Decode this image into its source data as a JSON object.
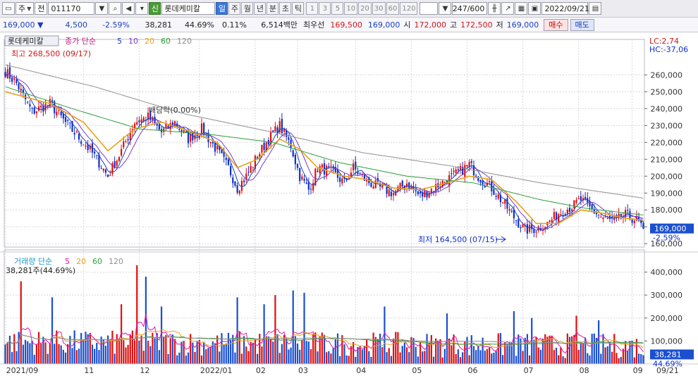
{
  "toolbar": {
    "period_a": "주",
    "period_b": "전",
    "code": "011170",
    "shin": "신",
    "name": "롯데케미칼",
    "periods": [
      "일",
      "주",
      "월",
      "년",
      "분",
      "초",
      "틱"
    ],
    "active_period": "일",
    "intervals": [
      "1",
      "3",
      "5",
      "10",
      "20",
      "30",
      "60",
      "120"
    ],
    "count": "247/600",
    "date": "2022/09/21"
  },
  "quote": {
    "price": "169,000",
    "change": "4,500",
    "change_pct": "-2.59%",
    "volume": "38,281",
    "volume_ratio": "44.69%",
    "turnover": "0.11%",
    "amount": "6,514백만",
    "best_label": "최우선",
    "best_ask": "169,500",
    "best_bid": "169,000",
    "open_label": "시",
    "open": "172,000",
    "high_label": "고",
    "high": "172,500",
    "low_label": "저",
    "low": "169,000",
    "buy": "매수",
    "sell": "매도"
  },
  "legend": {
    "name": "롯데케미칼",
    "price_label": "종가 단순",
    "ma": [
      "5",
      "10",
      "20",
      "60",
      "120"
    ],
    "ma_colors": [
      "#1a3fbf",
      "#7b3cc8",
      "#e8a21a",
      "#2e9e3a",
      "#909090"
    ],
    "vol_label": "거래량 단순",
    "vol_ma": [
      "5",
      "20",
      "60",
      "120"
    ],
    "vol_ma_colors": [
      "#e01ab0",
      "#e8a21a",
      "#2e9e3a",
      "#909090"
    ],
    "vol_value": "38,281주(44.69%)"
  },
  "annotations": {
    "high": "최고 268,500 (09/17)",
    "low": "최저 164,500 (07/15)",
    "dividend": "배당락(0.00%)",
    "lc": "LC:2,74",
    "hc": "HC:-37,06",
    "price_tag": "169,000",
    "price_pct": "-2.59%",
    "vol_tag": "38,281",
    "vol_pct": "44.69%"
  },
  "chart_data": [
    {
      "type": "candlestick",
      "y_ticks": [
        160000,
        170000,
        180000,
        190000,
        200000,
        210000,
        220000,
        230000,
        240000,
        250000,
        260000
      ],
      "y_tick_labels": [
        "160,000",
        "170,000",
        "180,000",
        "190,000",
        "200,000",
        "210,000",
        "220,000",
        "230,000",
        "240,000",
        "250,000",
        "260,000"
      ],
      "ylim": [
        158000,
        271000
      ],
      "x_labels": [
        "2021/09",
        "11",
        "12",
        "2022/01",
        "02",
        "03",
        "04",
        "05",
        "06",
        "07",
        "08",
        "09"
      ],
      "x_label_day": [
        0,
        35,
        60,
        87,
        112,
        131,
        157,
        182,
        207,
        232,
        257,
        281
      ],
      "last_label": "09/21",
      "close_knots": [
        [
          0,
          262000
        ],
        [
          5,
          255000
        ],
        [
          12,
          238000
        ],
        [
          20,
          243000
        ],
        [
          28,
          230000
        ],
        [
          35,
          220000
        ],
        [
          40,
          212000
        ],
        [
          46,
          200000
        ],
        [
          52,
          215000
        ],
        [
          58,
          232000
        ],
        [
          64,
          235000
        ],
        [
          70,
          226000
        ],
        [
          76,
          232000
        ],
        [
          82,
          222000
        ],
        [
          88,
          228000
        ],
        [
          95,
          215000
        ],
        [
          100,
          205000
        ],
        [
          104,
          193000
        ],
        [
          108,
          200000
        ],
        [
          113,
          212000
        ],
        [
          118,
          222000
        ],
        [
          123,
          230000
        ],
        [
          128,
          218000
        ],
        [
          132,
          200000
        ],
        [
          136,
          192000
        ],
        [
          140,
          205000
        ],
        [
          146,
          203000
        ],
        [
          152,
          196000
        ],
        [
          156,
          205000
        ],
        [
          162,
          197000
        ],
        [
          168,
          193000
        ],
        [
          174,
          190000
        ],
        [
          180,
          196000
        ],
        [
          186,
          188000
        ],
        [
          192,
          193000
        ],
        [
          198,
          198000
        ],
        [
          204,
          203000
        ],
        [
          208,
          207000
        ],
        [
          212,
          200000
        ],
        [
          218,
          193000
        ],
        [
          224,
          183000
        ],
        [
          229,
          174000
        ],
        [
          233,
          168000
        ],
        [
          238,
          169000
        ],
        [
          243,
          172000
        ],
        [
          248,
          178000
        ],
        [
          254,
          182000
        ],
        [
          258,
          186000
        ],
        [
          263,
          180000
        ],
        [
          268,
          175000
        ],
        [
          273,
          173000
        ],
        [
          278,
          177000
        ],
        [
          283,
          174000
        ],
        [
          286,
          169000
        ]
      ],
      "ma20_knots": [
        [
          0,
          250000
        ],
        [
          20,
          243000
        ],
        [
          35,
          232000
        ],
        [
          46,
          215000
        ],
        [
          58,
          228000
        ],
        [
          70,
          232000
        ],
        [
          82,
          227000
        ],
        [
          95,
          220000
        ],
        [
          104,
          205000
        ],
        [
          113,
          210000
        ],
        [
          123,
          222000
        ],
        [
          132,
          216000
        ],
        [
          140,
          205000
        ],
        [
          152,
          200000
        ],
        [
          162,
          198000
        ],
        [
          174,
          193000
        ],
        [
          186,
          192000
        ],
        [
          198,
          196000
        ],
        [
          208,
          200000
        ],
        [
          218,
          198000
        ],
        [
          229,
          185000
        ],
        [
          238,
          172000
        ],
        [
          248,
          172000
        ],
        [
          258,
          180000
        ],
        [
          268,
          178000
        ],
        [
          278,
          175000
        ],
        [
          286,
          174000
        ]
      ],
      "ma60_knots": [
        [
          0,
          253000
        ],
        [
          30,
          240000
        ],
        [
          60,
          228000
        ],
        [
          90,
          225000
        ],
        [
          120,
          220000
        ],
        [
          150,
          208000
        ],
        [
          180,
          200000
        ],
        [
          210,
          196000
        ],
        [
          240,
          186000
        ],
        [
          260,
          181000
        ],
        [
          286,
          177000
        ]
      ],
      "ma120_knots": [
        [
          0,
          266000
        ],
        [
          40,
          253000
        ],
        [
          80,
          237000
        ],
        [
          120,
          226000
        ],
        [
          160,
          214000
        ],
        [
          200,
          206000
        ],
        [
          240,
          196000
        ],
        [
          286,
          187000
        ]
      ]
    },
    {
      "type": "bar",
      "y_ticks": [
        100000,
        200000,
        300000,
        400000
      ],
      "y_tick_labels": [
        "100,000",
        "200,000",
        "300,000",
        "400,000"
      ],
      "ylim": [
        0,
        460000
      ],
      "spike_days": [
        [
          7,
          360000
        ],
        [
          21,
          290000
        ],
        [
          52,
          260000
        ],
        [
          59,
          430000
        ],
        [
          63,
          380000
        ],
        [
          70,
          250000
        ],
        [
          104,
          290000
        ],
        [
          116,
          260000
        ],
        [
          121,
          300000
        ],
        [
          129,
          320000
        ],
        [
          134,
          310000
        ],
        [
          170,
          250000
        ],
        [
          198,
          220000
        ],
        [
          228,
          230000
        ],
        [
          236,
          200000
        ],
        [
          256,
          210000
        ],
        [
          266,
          190000
        ]
      ]
    }
  ]
}
